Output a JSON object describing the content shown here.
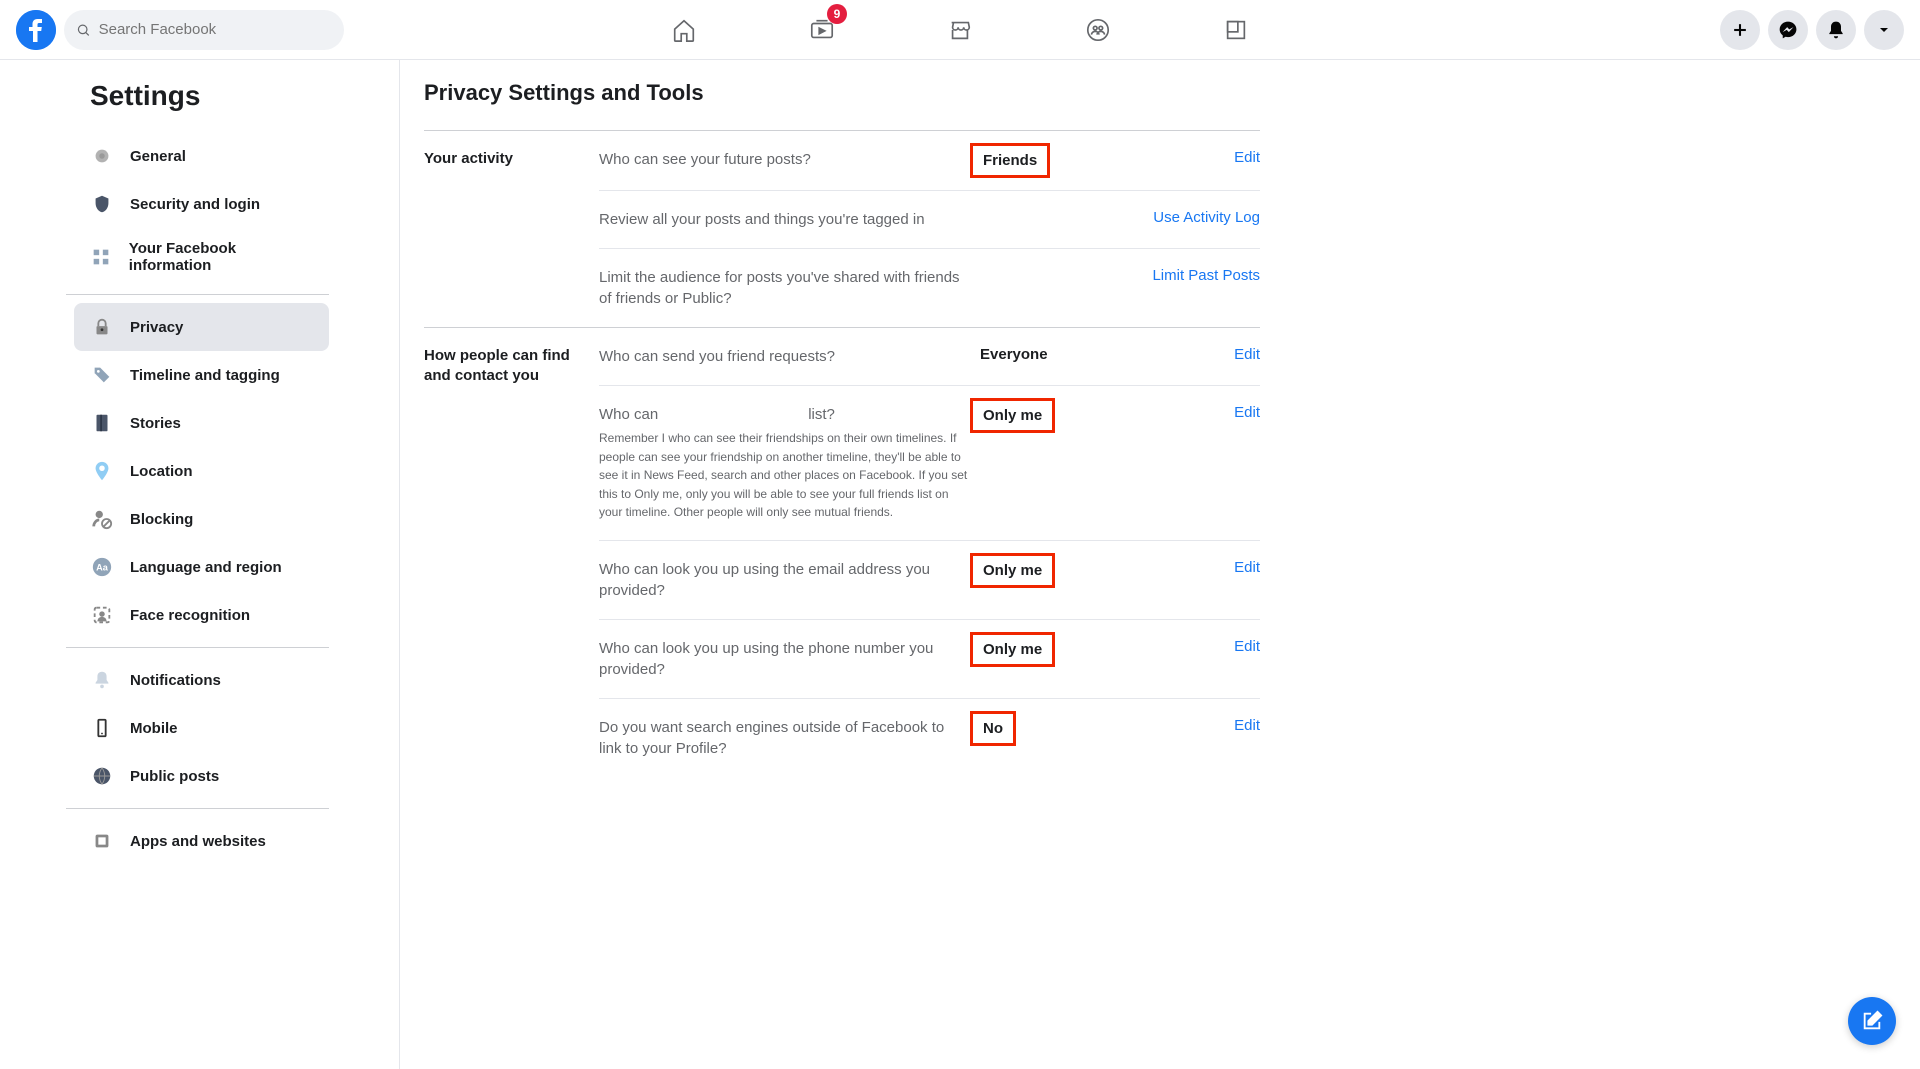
{
  "search": {
    "placeholder": "Search Facebook"
  },
  "nav_badge": "9",
  "sidebar": {
    "title": "Settings",
    "items": [
      {
        "label": "General",
        "icon": "gear"
      },
      {
        "label": "Security and login",
        "icon": "shield"
      },
      {
        "label": "Your Facebook information",
        "icon": "grid"
      },
      {
        "label": "Privacy",
        "icon": "lock",
        "active": true
      },
      {
        "label": "Timeline and tagging",
        "icon": "tag"
      },
      {
        "label": "Stories",
        "icon": "book"
      },
      {
        "label": "Location",
        "icon": "pin"
      },
      {
        "label": "Blocking",
        "icon": "block"
      },
      {
        "label": "Language and region",
        "icon": "lang"
      },
      {
        "label": "Face recognition",
        "icon": "face"
      },
      {
        "label": "Notifications",
        "icon": "bell"
      },
      {
        "label": "Mobile",
        "icon": "phone"
      },
      {
        "label": "Public posts",
        "icon": "globe"
      },
      {
        "label": "Apps and websites",
        "icon": "apps"
      }
    ]
  },
  "content": {
    "title": "Privacy Settings and Tools",
    "sections": [
      {
        "label": "Your activity",
        "rows": [
          {
            "q": "Who can see your future posts?",
            "v": "Friends",
            "a": "Edit",
            "hl": true
          },
          {
            "q": "Review all your posts and things you're tagged in",
            "v": "",
            "a": "Use Activity Log"
          },
          {
            "q": "Limit the audience for posts you've shared with friends of friends or Public?",
            "v": "",
            "a": "Limit Past Posts"
          }
        ]
      },
      {
        "label": "How people can find and contact you",
        "rows": [
          {
            "q": "Who can send you friend requests?",
            "v": "Everyone",
            "a": "Edit"
          },
          {
            "q": "Who can                                    list?",
            "sub": "Remember                                                    I who can see their friendships on their own timelines. If people can see your friendship on another timeline, they'll be able to see it in News Feed, search and other places on Facebook. If you set this to Only me, only you will be able to see your full friends list on your timeline. Other people will only see mutual friends.",
            "v": "Only me",
            "a": "Edit",
            "hl": true
          },
          {
            "q": "Who can look you up using the email address you provided?",
            "v": "Only me",
            "a": "Edit",
            "hl": true
          },
          {
            "q": "Who can look you up using the phone number you provided?",
            "v": "Only me",
            "a": "Edit",
            "hl": true
          },
          {
            "q": "Do you want search engines outside of Facebook to link to your Profile?",
            "v": "No",
            "a": "Edit",
            "hl": true
          }
        ]
      }
    ]
  }
}
